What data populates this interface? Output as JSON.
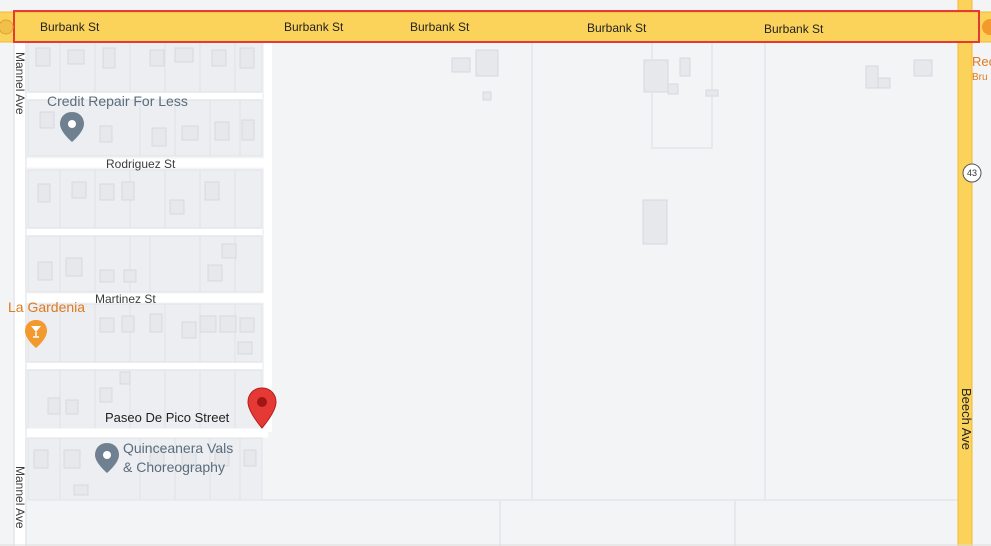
{
  "roads": {
    "burbank": [
      "Burbank St",
      "Burbank St",
      "Burbank St",
      "Burbank St",
      "Burbank St"
    ],
    "rodriguez": "Rodriguez St",
    "martinez": "Martinez St",
    "mannel_top": "Mannel Ave",
    "mannel_bottom": "Mannel Ave",
    "beech": "Beech Ave",
    "route_shield": "43"
  },
  "places": {
    "credit_repair": "Credit Repair For Less",
    "la_gardenia": "La Gardenia",
    "quinceanera_line1": "Quinceanera Vals",
    "quinceanera_line2": "& Choreography",
    "paseo": "Paseo De Pico Street",
    "edge_label_1": "Rec",
    "edge_label_2": "Bru"
  },
  "colors": {
    "land": "#f3f4f6",
    "block": "#eceef1",
    "building": "#e6e8ec",
    "building_stroke": "#d9dce1",
    "street": "#ffffff",
    "highway": "#fcd35a",
    "highway_edge": "#f0b73a",
    "highlight_border": "#e53935",
    "pin_red": "#e53935",
    "poi_gray": "#6f8190",
    "poi_orange": "#f29a2e"
  },
  "icons": {
    "credit_repair": "location-pin-icon",
    "la_gardenia": "bar-icon",
    "quinceanera": "location-pin-icon",
    "paseo": "dropped-pin-icon",
    "route": "route-shield-icon"
  },
  "highlight": {
    "target": "Burbank St"
  }
}
